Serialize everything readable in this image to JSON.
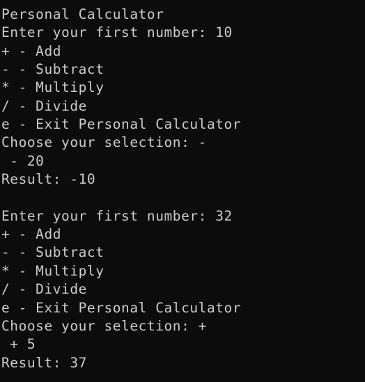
{
  "terminal": {
    "background": "#0c0c0c",
    "foreground": "#cccccc",
    "lines": [
      "Personal Calculator",
      "Enter your first number: 10",
      "+ - Add",
      "- - Subtract",
      "* - Multiply",
      "/ - Divide",
      "e - Exit Personal Calculator",
      "Choose your selection: -",
      " - 20",
      "Result: -10",
      "",
      "Enter your first number: 32",
      "+ - Add",
      "- - Subtract",
      "* - Multiply",
      "/ - Divide",
      "e - Exit Personal Calculator",
      "Choose your selection: +",
      " + 5",
      "Result: 37"
    ]
  }
}
